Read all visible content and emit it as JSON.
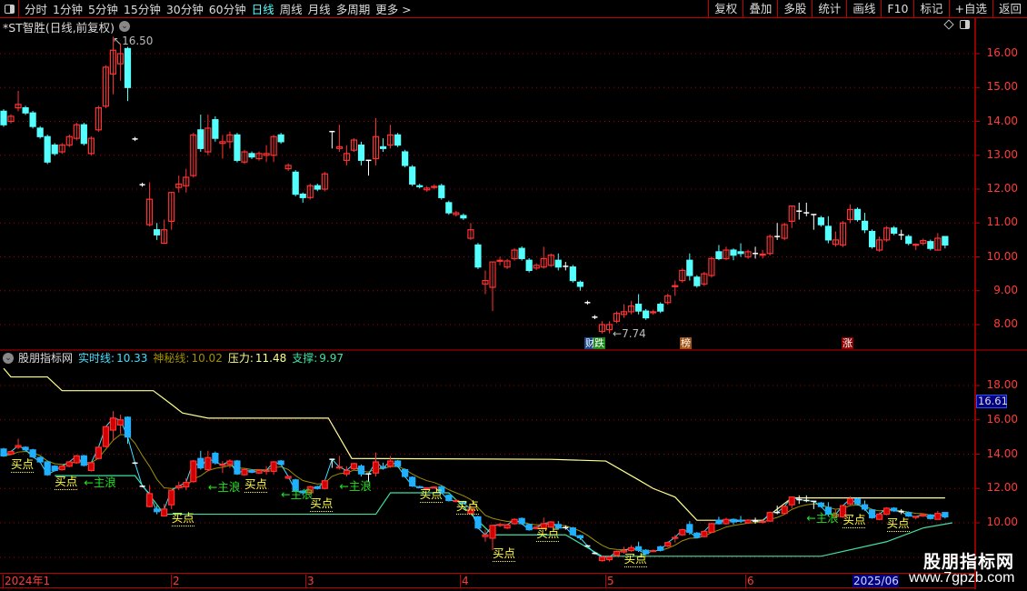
{
  "toolbar": {
    "periods": [
      "分时",
      "1分钟",
      "5分钟",
      "15分钟",
      "30分钟",
      "60分钟",
      "日线",
      "周线",
      "月线",
      "多周期",
      "更多 >"
    ],
    "active_period": "日线",
    "right_buttons": [
      "复权",
      "叠加",
      "多股",
      "统计",
      "画线",
      "F10",
      "标记",
      "+自选",
      "返回"
    ]
  },
  "title": "*ST智胜(日线,前复权)",
  "main_axis": [
    "16.00",
    "15.00",
    "14.00",
    "13.00",
    "12.00",
    "11.00",
    "10.00",
    "9.00",
    "8.00"
  ],
  "annotations": {
    "high": "16.50",
    "low": "7.74",
    "high_arrow": "↖",
    "low_arrow": "←"
  },
  "markers": [
    {
      "text": "财",
      "color": "#1a4a8a"
    },
    {
      "text": "跌",
      "color": "#1a8a1a"
    },
    {
      "text": "榜",
      "color": "#a05010"
    },
    {
      "text": "涨",
      "color": "#900000"
    }
  ],
  "indicator": {
    "name": "股朋指标网",
    "realtime_label": "实时线:",
    "realtime_value": "10.33",
    "mystery_label": "神秘线:",
    "mystery_value": "10.02",
    "pressure_label": "压力:",
    "pressure_value": "11.48",
    "support_label": "支撑:",
    "support_value": "9.97"
  },
  "lower_axis": [
    "18.00",
    "16.00",
    "14.00",
    "12.00",
    "10.00"
  ],
  "lower_highlight": "16.61",
  "time_axis": [
    "2024年1",
    "2",
    "3",
    "4",
    "5",
    "6",
    "2025/06"
  ],
  "signal_labels": {
    "buy": "买点",
    "wave": "←主浪"
  },
  "watermark": {
    "name": "股朋指标网",
    "url": "www.7gpzb.com"
  },
  "colors": {
    "up": "#ff3232",
    "down": "#54ffff",
    "grid": "#a00000",
    "pressure": "#ffff90",
    "support": "#40e0a0",
    "mystery": "#a09000",
    "realtime": "#40e0ff"
  },
  "chart_data": {
    "type": "candlestick",
    "ylim_main": [
      7.5,
      16.7
    ],
    "ylim_lower": [
      7.5,
      19.5
    ],
    "candles": [
      [
        14.3,
        13.9
      ],
      [
        14.0,
        14.15
      ],
      [
        14.4,
        14.5,
        14.9,
        14.3
      ],
      [
        14.4,
        14.25
      ],
      [
        14.25,
        13.85
      ],
      [
        13.8,
        13.55
      ],
      [
        13.55,
        12.8
      ],
      [
        13.3,
        13.05
      ],
      [
        13.1,
        13.3
      ],
      [
        13.3,
        13.55
      ],
      [
        13.5,
        13.9
      ],
      [
        13.9,
        13.35
      ],
      [
        13.05,
        13.5
      ],
      [
        13.75,
        14.4
      ],
      [
        14.45,
        15.6
      ],
      [
        15.4,
        16.1,
        16.5,
        14.8
      ],
      [
        15.7,
        16.0,
        16.3,
        15.2
      ],
      [
        16.15,
        15.0,
        16.2,
        14.6
      ],
      [
        13.48,
        13.48
      ],
      [
        12.13,
        12.13
      ],
      [
        10.95,
        11.7,
        12.2,
        10.9
      ],
      [
        10.8,
        10.65,
        11.0,
        10.5
      ],
      [
        10.4,
        10.8,
        11.1,
        10.4
      ],
      [
        11.05,
        11.9,
        11.9,
        10.8
      ],
      [
        12.05,
        12.15,
        12.4,
        11.9
      ],
      [
        12.1,
        12.35,
        12.6,
        11.9
      ],
      [
        12.4,
        13.6
      ],
      [
        13.75,
        13.2,
        14.2,
        13.1
      ],
      [
        13.1,
        13.8,
        14.2,
        13.0
      ],
      [
        14.05,
        13.5,
        14.15,
        13.4
      ],
      [
        13.35,
        13.4,
        13.6,
        12.9
      ],
      [
        13.4,
        13.6,
        13.7,
        13.2
      ],
      [
        13.6,
        12.85
      ],
      [
        12.8,
        13.1
      ],
      [
        13.05,
        12.95
      ],
      [
        12.9,
        13.05
      ],
      [
        13.0,
        13.05,
        13.3,
        12.8
      ],
      [
        13.0,
        13.55,
        13.6,
        12.8
      ],
      [
        13.6,
        13.4
      ],
      [
        12.6,
        12.7
      ],
      [
        12.5,
        11.85
      ],
      [
        11.85,
        11.75,
        11.9,
        11.6
      ],
      [
        11.75,
        12.1
      ],
      [
        12.1,
        12.0
      ],
      [
        12.0,
        12.45
      ],
      [
        13.7,
        13.7,
        13.7,
        13.2
      ],
      [
        13.2,
        13.25,
        13.9,
        13.1
      ],
      [
        12.85,
        13.05,
        13.3,
        12.7
      ],
      [
        13.15,
        13.45,
        13.5,
        13.1
      ],
      [
        13.3,
        12.85,
        13.4,
        12.7
      ],
      [
        12.85,
        12.85,
        12.85,
        12.4
      ],
      [
        12.9,
        13.55,
        14.1,
        12.7
      ],
      [
        13.25,
        13.2,
        13.5,
        13.1
      ],
      [
        13.3,
        13.6,
        13.9,
        13.2
      ],
      [
        13.6,
        13.3
      ],
      [
        13.1,
        12.7
      ],
      [
        12.65,
        12.15
      ],
      [
        12.1,
        12.08
      ],
      [
        11.98,
        12.03
      ],
      [
        12.05,
        12.08
      ],
      [
        12.1,
        11.75
      ],
      [
        11.6,
        11.3
      ],
      [
        11.25,
        11.3
      ],
      [
        11.22,
        11.15
      ],
      [
        10.55,
        10.8,
        11.0,
        10.5
      ],
      [
        10.35,
        9.7
      ],
      [
        9.2,
        9.3,
        9.6,
        8.9
      ],
      [
        9.1,
        9.85,
        9.85,
        8.4
      ],
      [
        9.87,
        9.9,
        10.0,
        9.75
      ],
      [
        9.7,
        9.88
      ],
      [
        9.95,
        10.2
      ],
      [
        10.25,
        9.95
      ],
      [
        9.9,
        9.6
      ],
      [
        9.67,
        9.75
      ],
      [
        9.7,
        9.95,
        10.3,
        9.65
      ],
      [
        9.75,
        10.05,
        10.1,
        9.7
      ],
      [
        9.9,
        9.7,
        10.1,
        9.6
      ],
      [
        9.72,
        9.72,
        9.85,
        9.6
      ],
      [
        9.7,
        9.3
      ],
      [
        9.25,
        9.13,
        9.3,
        9.0
      ],
      [
        8.65,
        8.65
      ],
      [
        8.22,
        8.22
      ],
      [
        7.8,
        8.0,
        8.1,
        7.74
      ],
      [
        7.85,
        8.0,
        8.1,
        7.74
      ],
      [
        8.1,
        8.33
      ],
      [
        8.3,
        8.38,
        8.6,
        8.2
      ],
      [
        8.38,
        8.55,
        8.7,
        8.3
      ],
      [
        8.6,
        8.4,
        8.9,
        8.3
      ],
      [
        8.4,
        8.2
      ],
      [
        8.35,
        8.38
      ],
      [
        8.6,
        8.4
      ],
      [
        8.65,
        8.85
      ],
      [
        9.12,
        9.15,
        9.3,
        8.85
      ],
      [
        9.3,
        9.6
      ],
      [
        9.9,
        9.45,
        10.1,
        9.3
      ],
      [
        9.4,
        9.15
      ],
      [
        9.2,
        9.5
      ],
      [
        9.45,
        9.95
      ],
      [
        10.15,
        9.95,
        10.35,
        9.9
      ],
      [
        9.95,
        10.2,
        10.3,
        9.9
      ],
      [
        10.2,
        10.05,
        10.25,
        9.9
      ],
      [
        10.15,
        10.1,
        10.4,
        10.0
      ],
      [
        10.0,
        10.15
      ],
      [
        10.1,
        10.1,
        10.3,
        9.95
      ],
      [
        10.05,
        10.08,
        10.2,
        9.95
      ],
      [
        10.1,
        10.6
      ],
      [
        10.6,
        10.6,
        11.0,
        10.5
      ],
      [
        10.55,
        10.95
      ],
      [
        11.05,
        11.5,
        11.5,
        10.85
      ],
      [
        11.35,
        11.35,
        11.6,
        11.1
      ],
      [
        11.3,
        11.3,
        11.6,
        11.2
      ],
      [
        11.25,
        11.25,
        11.25,
        10.8
      ],
      [
        11.15,
        10.95
      ],
      [
        10.9,
        10.5,
        11.2,
        10.4
      ],
      [
        10.37,
        10.5,
        10.75,
        10.3
      ],
      [
        10.35,
        11.0
      ],
      [
        11.1,
        11.4,
        11.55,
        11.0
      ],
      [
        11.4,
        11.1
      ],
      [
        11.05,
        10.8,
        11.3,
        10.7
      ],
      [
        10.75,
        10.3
      ],
      [
        10.2,
        10.5,
        10.6,
        10.15
      ],
      [
        10.5,
        10.85
      ],
      [
        10.85,
        10.7
      ],
      [
        10.65,
        10.65,
        10.8,
        10.5
      ],
      [
        10.6,
        10.4
      ],
      [
        10.35,
        10.37,
        10.4,
        10.2
      ],
      [
        10.4,
        10.48
      ],
      [
        10.45,
        10.25
      ],
      [
        10.2,
        10.55,
        10.7,
        10.2
      ],
      [
        10.6,
        10.35,
        10.6,
        10.25
      ]
    ],
    "pressure_line": [
      [
        0,
        19.0
      ],
      [
        1,
        18.5
      ],
      [
        6,
        18.5
      ],
      [
        8,
        17.7
      ],
      [
        20.5,
        17.7
      ],
      [
        23,
        16.9
      ],
      [
        24.5,
        16.4
      ],
      [
        28,
        16.1
      ],
      [
        44.5,
        16.1
      ],
      [
        47.7,
        13.75
      ],
      [
        75,
        13.7
      ],
      [
        82.5,
        13.6
      ],
      [
        87,
        12.5
      ],
      [
        89,
        12.0
      ],
      [
        92,
        11.5
      ],
      [
        95,
        10.15
      ],
      [
        104,
        10.15
      ],
      [
        108,
        11.45
      ],
      [
        129,
        11.45
      ]
    ],
    "support_line": [
      [
        7,
        12.75
      ],
      [
        18,
        12.75
      ],
      [
        22,
        10.5
      ],
      [
        51,
        10.5
      ],
      [
        53,
        11.75
      ],
      [
        61,
        11.75
      ],
      [
        67,
        9.3
      ],
      [
        77,
        9.3
      ],
      [
        82,
        8.05
      ],
      [
        112,
        8.05
      ],
      [
        121,
        8.9
      ],
      [
        126,
        9.7
      ],
      [
        130,
        10.0
      ]
    ],
    "buy_points": [
      [
        2,
        13.55
      ],
      [
        8,
        12.55
      ],
      [
        24,
        10.4
      ],
      [
        34,
        12.4
      ],
      [
        43,
        11.25
      ],
      [
        58,
        11.8
      ],
      [
        63,
        11.1
      ],
      [
        68,
        8.35
      ],
      [
        74,
        9.5
      ],
      [
        86,
        8.05
      ],
      [
        116,
        10.3
      ],
      [
        122,
        10.1
      ]
    ],
    "wave_points": [
      [
        12,
        12.5
      ],
      [
        29,
        12.2
      ],
      [
        39,
        11.8
      ],
      [
        47,
        12.3
      ],
      [
        111,
        10.4
      ]
    ]
  }
}
